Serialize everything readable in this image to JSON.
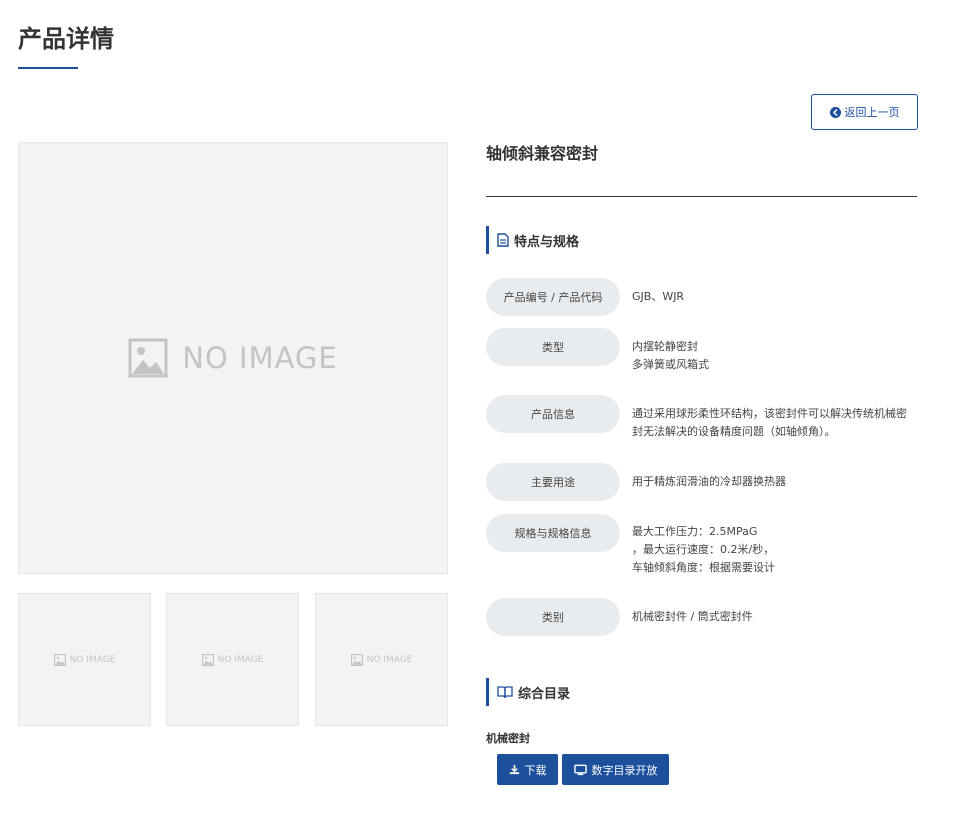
{
  "page": {
    "title": "产品详情"
  },
  "nav": {
    "back_label": "返回上一页"
  },
  "gallery": {
    "main_placeholder": "NO IMAGE",
    "thumbs": [
      "NO IMAGE",
      "NO IMAGE",
      "NO IMAGE"
    ]
  },
  "product": {
    "name": "轴倾斜兼容密封"
  },
  "specs": {
    "heading": "特点与规格",
    "rows": [
      {
        "label": "产品编号 / 产品代码",
        "lines": [
          "GJB、WJR"
        ]
      },
      {
        "label": "类型",
        "lines": [
          "内摆轮静密封",
          "多弹簧或风箱式"
        ]
      },
      {
        "label": "产品信息",
        "lines": [
          "通过采用球形柔性环结构，该密封件可以解决传统机械密",
          "封无法解决的设备精度问题（如轴倾角）。"
        ]
      },
      {
        "label": "主要用途",
        "lines": [
          "用于精炼润滑油的冷却器换热器"
        ]
      },
      {
        "label": "规格与规格信息",
        "lines": [
          "最大工作压力：2.5MPaG",
          "，最大运行速度：0.2米/秒，",
          "车轴倾斜角度：根据需要设计"
        ]
      },
      {
        "label": "类别",
        "lines": [
          "机械密封件 / 筒式密封件"
        ]
      }
    ]
  },
  "catalog": {
    "heading": "综合目录",
    "category": "机械密封",
    "download_label": "下载",
    "digital_label": "数字目录开放"
  },
  "colors": {
    "accent": "#1c4f9c",
    "label_bg": "#e9ecef",
    "placeholder_bg": "#f3f3f3"
  }
}
